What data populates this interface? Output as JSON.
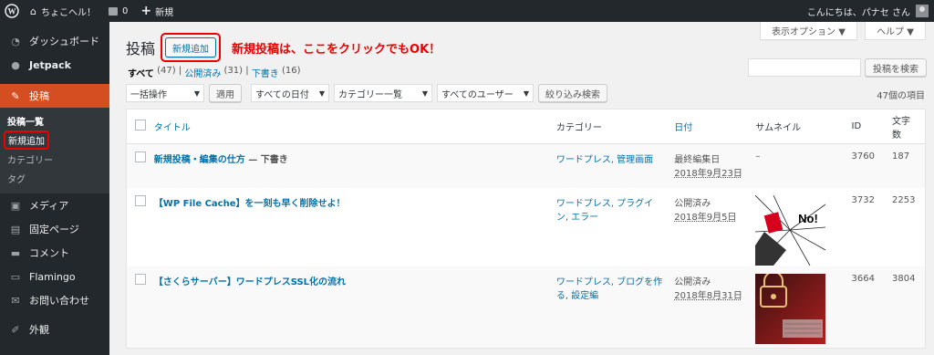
{
  "adminbar": {
    "site_name": "ちょこヘル！",
    "comments_count": "0",
    "new_label": "新規",
    "greeting": "こんにちは、パナセ さん"
  },
  "sidebar": {
    "items": [
      {
        "label": "ダッシュボード",
        "icon": "dashboard-icon"
      },
      {
        "label": "Jetpack",
        "icon": "jetpack-icon"
      },
      {
        "label": "投稿",
        "icon": "pin-icon"
      },
      {
        "label": "メディア",
        "icon": "media-icon"
      },
      {
        "label": "固定ページ",
        "icon": "page-icon"
      },
      {
        "label": "コメント",
        "icon": "comment-icon"
      },
      {
        "label": "Flamingo",
        "icon": "flamingo-icon"
      },
      {
        "label": "お問い合わせ",
        "icon": "mail-icon"
      },
      {
        "label": "外観",
        "icon": "brush-icon"
      }
    ],
    "submenu": [
      "投稿一覧",
      "新規追加",
      "カテゴリー",
      "タグ"
    ]
  },
  "page": {
    "title": "投稿",
    "add_new": "新規追加",
    "annotation": "新規投稿は、ここをクリックでもOK！",
    "screen_options": "表示オプション ▼",
    "help": "ヘルプ ▼",
    "search_button": "投稿を検索",
    "item_count": "47個の項目"
  },
  "filters": {
    "all": "すべて",
    "all_count": "(47)",
    "published": "公開済み",
    "published_count": "(31)",
    "draft": "下書き",
    "draft_count": "(16)"
  },
  "toolbar": {
    "bulk": "一括操作",
    "apply": "適用",
    "dates": "すべての日付",
    "categories": "カテゴリー一覧",
    "users": "すべてのユーザー",
    "filter": "絞り込み検索"
  },
  "table": {
    "headers": {
      "title": "タイトル",
      "category": "カテゴリー",
      "date": "日付",
      "thumbnail": "サムネイル",
      "id": "ID",
      "chars": "文字数"
    },
    "rows": [
      {
        "title": "新規投稿・編集の仕方",
        "suffix": " — 下書き",
        "categories": "ワードプレス, 管理画面",
        "status": "最終編集日",
        "date": "2018年9月23日",
        "thumb": "–",
        "id": "3760",
        "chars": "187"
      },
      {
        "title": "【WP File Cache】を一刻も早く削除せよ！",
        "suffix": "",
        "categories": "ワードプレス, プラグイン, エラー",
        "status": "公開済み",
        "date": "2018年9月5日",
        "thumb_text": "No!",
        "id": "3732",
        "chars": "2253"
      },
      {
        "title": "【さくらサーバー】ワードプレスSSL化の流れ",
        "suffix": "",
        "categories": "ワードプレス, ブログを作る, 設定編",
        "status": "公開済み",
        "date": "2018年8月31日",
        "id": "3664",
        "chars": "3804"
      }
    ]
  },
  "colors": {
    "adminbar": "#23282d",
    "accent": "#0073aa",
    "posts_menu": "#d54e21",
    "annotation": "#e00000"
  }
}
